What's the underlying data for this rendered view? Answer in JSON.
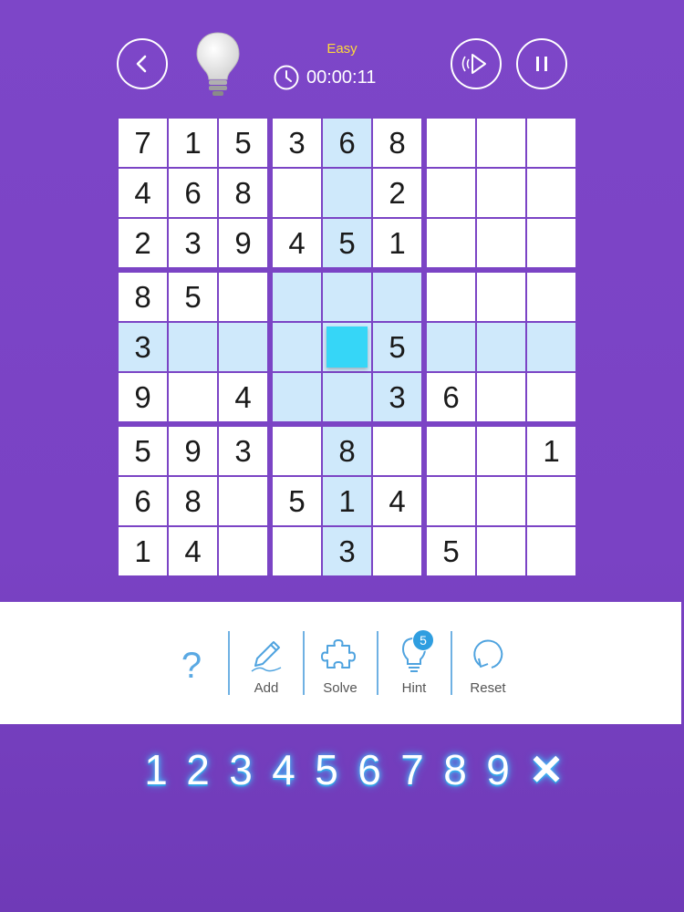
{
  "header": {
    "difficulty": "Easy",
    "timer": "00:00:11",
    "icons": {
      "back": "chevron-left-icon",
      "bulb": "lightbulb-icon",
      "clock": "clock-icon",
      "sound": "speaker-icon",
      "pause": "pause-icon"
    }
  },
  "board": {
    "grid": [
      [
        "7",
        "1",
        "5",
        "3",
        "6",
        "8",
        "",
        "",
        ""
      ],
      [
        "4",
        "6",
        "8",
        "",
        "",
        "2",
        "",
        "",
        ""
      ],
      [
        "2",
        "3",
        "9",
        "4",
        "5",
        "1",
        "",
        "",
        ""
      ],
      [
        "8",
        "5",
        "",
        "",
        "",
        "",
        "",
        "",
        ""
      ],
      [
        "3",
        "",
        "",
        "",
        "",
        "5",
        "",
        "",
        ""
      ],
      [
        "9",
        "",
        "4",
        "",
        "",
        "3",
        "6",
        "",
        ""
      ],
      [
        "5",
        "9",
        "3",
        "",
        "8",
        "",
        "",
        "",
        "1"
      ],
      [
        "6",
        "8",
        "",
        "5",
        "1",
        "4",
        "",
        "",
        ""
      ],
      [
        "1",
        "4",
        "",
        "",
        "3",
        "",
        "5",
        "",
        ""
      ]
    ],
    "selected": {
      "row": 4,
      "col": 4
    },
    "colors": {
      "highlight": "#cfe9fb",
      "selected": "#36d6f7",
      "cell": "#ffffff",
      "border": "#7b44c5"
    }
  },
  "toolbar": {
    "help_label": "?",
    "add_label": "Add",
    "solve_label": "Solve",
    "hint_label": "Hint",
    "hint_count": "5",
    "reset_label": "Reset"
  },
  "numpad": {
    "keys": [
      "1",
      "2",
      "3",
      "4",
      "5",
      "6",
      "7",
      "8",
      "9"
    ],
    "erase": "✕"
  }
}
